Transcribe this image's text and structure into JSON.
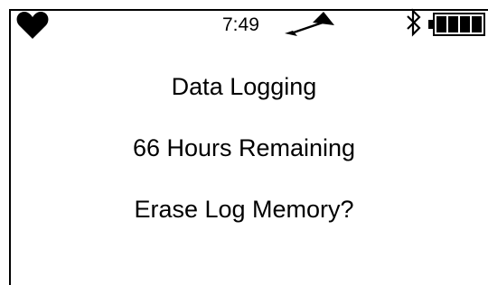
{
  "status_bar": {
    "time": "7:49",
    "heart_icon": "heart-icon",
    "signal_icon": "signal-icon",
    "bluetooth_icon": "bluetooth-icon",
    "battery_icon": "battery-icon",
    "battery_level": 1.0,
    "battery_bars": 4
  },
  "screen": {
    "title": "Data Logging",
    "status": "66 Hours Remaining",
    "prompt": "Erase Log Memory?"
  },
  "colors": {
    "foreground": "#000000",
    "background": "#ffffff"
  }
}
